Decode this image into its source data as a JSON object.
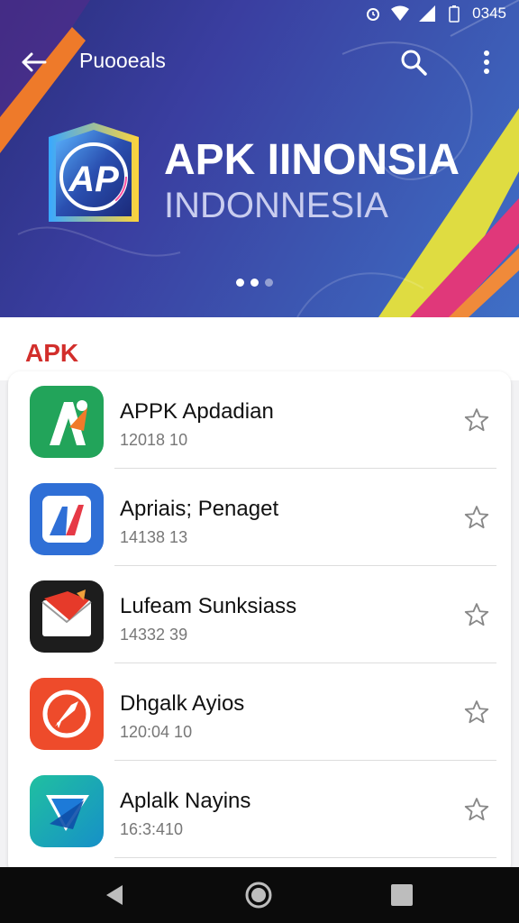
{
  "status_bar": {
    "time": "0345"
  },
  "top_bar": {
    "title": "Puooeals"
  },
  "hero": {
    "logo_text": "AP",
    "title": "APK IINONSIA",
    "subtitle": "INDONNESIA",
    "carousel_pages": 3,
    "carousel_active": 2
  },
  "section": {
    "label": "APK"
  },
  "apps": [
    {
      "name": "APPK Apdadian",
      "meta": "12018 10",
      "icon": "apk-a-icon",
      "color": "#22a45a"
    },
    {
      "name": "Apriais; Penaget",
      "meta": "14138 13",
      "icon": "apk-ad-icon",
      "color": "#2f6fd6"
    },
    {
      "name": "Lufeam Sunksiass",
      "meta": "14332 39",
      "icon": "envelope-icon",
      "color": "#1d1d1d"
    },
    {
      "name": "Dhgalk Ayios",
      "meta": "120:04 10",
      "icon": "compass-icon",
      "color": "#ee4b2b"
    },
    {
      "name": "Aplalk Nayins",
      "meta": "16:3:410",
      "icon": "play-arrow-icon",
      "color": "#18a7b5"
    }
  ],
  "colors": {
    "accent": "#d22e2b",
    "hero_start": "#2a2f7e",
    "hero_end": "#3f6fc6"
  }
}
